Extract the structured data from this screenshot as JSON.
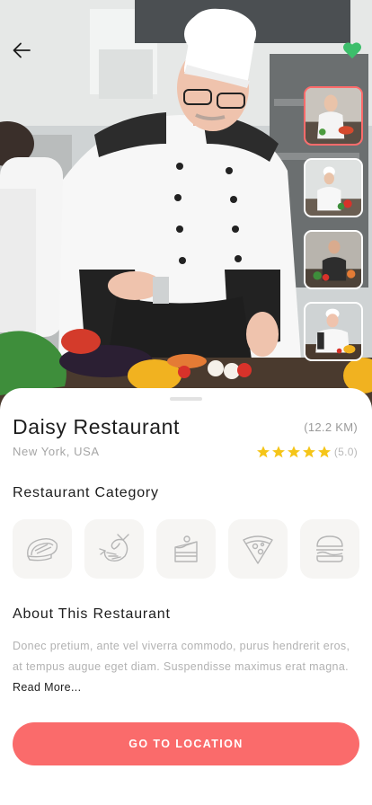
{
  "colors": {
    "accent": "#fa6b6b",
    "active_thumb_border": "#ff6b6b",
    "favorite": "#3dbe6b",
    "star": "#f5c518",
    "tile_bg": "#f6f5f3"
  },
  "header": {
    "back_icon": "arrow-left-icon",
    "favorite_icon": "heart-icon",
    "favorite_active": true
  },
  "gallery": {
    "thumbnails": [
      {
        "icon": "chef-photo",
        "active": true
      },
      {
        "icon": "chef-photo",
        "active": false
      },
      {
        "icon": "chef-photo",
        "active": false
      },
      {
        "icon": "chef-photo",
        "active": false
      }
    ]
  },
  "restaurant": {
    "name": "Daisy Restaurant",
    "distance": "(12.2 KM)",
    "location": "New York, USA",
    "rating_stars": 5,
    "rating_label": "(5.0)"
  },
  "categories": {
    "title": "Restaurant Category",
    "items": [
      {
        "icon": "steak-icon"
      },
      {
        "icon": "shrimp-icon"
      },
      {
        "icon": "cake-icon"
      },
      {
        "icon": "pizza-icon"
      },
      {
        "icon": "burger-icon"
      }
    ]
  },
  "about": {
    "title": "About This Restaurant",
    "text": "Donec pretium, ante vel viverra commodo, purus hendrerit eros, at tempus augue eget diam. Suspendisse maximus erat magna.",
    "read_more": "Read More..."
  },
  "cta": {
    "label": "GO TO LOCATION"
  }
}
